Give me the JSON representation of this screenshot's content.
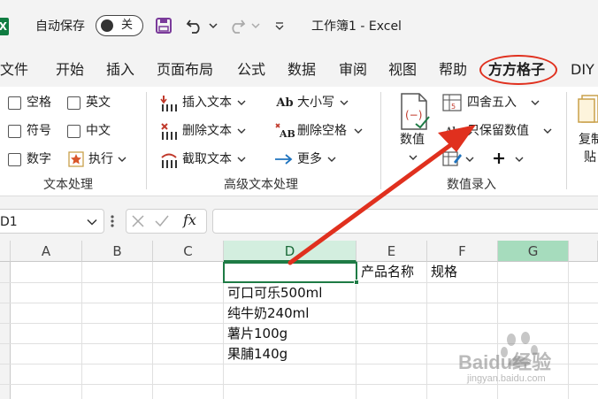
{
  "titlebar": {
    "autosave_label": "自动保存",
    "autosave_state": "关",
    "doc_title": "工作簿1  -  Excel"
  },
  "tabs": [
    "文件",
    "开始",
    "插入",
    "页面布局",
    "公式",
    "数据",
    "审阅",
    "视图",
    "帮助",
    "方方格子",
    "DIY"
  ],
  "active_tab": "方方格子",
  "ribbon": {
    "text_group": {
      "checkboxes": [
        "空格",
        "英文",
        "符号",
        "中文",
        "数字"
      ],
      "exec_label": "执行",
      "label": "文本处理"
    },
    "advanced_group": {
      "insert_text": "插入文本",
      "delete_text": "删除文本",
      "extract_text": "截取文本",
      "case": "大小写",
      "delete_space": "删除空格",
      "more": "更多",
      "label": "高级文本处理"
    },
    "number_group": {
      "values_label": "数值",
      "round": "四舍五入",
      "keep_values": "只保留数值",
      "label": "数值录入"
    },
    "copy_partial": "复制",
    "paste_partial": "贴"
  },
  "formula_bar": {
    "namebox": "D1",
    "fx": "fx"
  },
  "grid": {
    "columns": [
      "A",
      "B",
      "C",
      "D",
      "E",
      "F",
      "G"
    ],
    "cells": {
      "E1": "产品名称",
      "F1": "规格",
      "D2": "可口可乐500ml",
      "D3": "纯牛奶240ml",
      "D4": "薯片100g",
      "D5": "果脯140g"
    }
  },
  "colors": {
    "excel_green": "#107c41",
    "selection_green": "#1e7b45",
    "annotation_red": "#e0301e"
  },
  "watermark": {
    "brand": "Baidu经验",
    "url": "jingyan.baidu.com"
  }
}
